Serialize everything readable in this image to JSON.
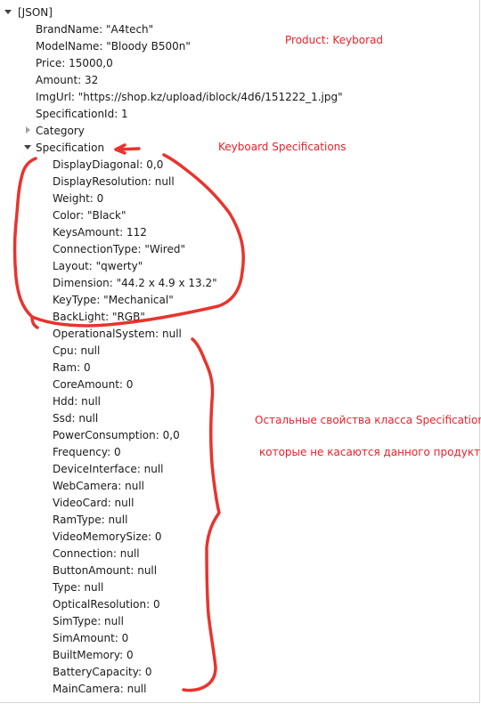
{
  "root": {
    "label": "[JSON]"
  },
  "product_fields": [
    "BrandName: \"A4tech\"",
    "ModelName: \"Bloody B500n\"",
    "Price: 15000,0",
    "Amount: 32",
    "ImgUrl: \"https://shop.kz/upload/iblock/4d6/151222_1.jpg\"",
    "SpecificationId: 1"
  ],
  "category_node": {
    "label": "Category"
  },
  "specification_node": {
    "label": "Specification"
  },
  "keyboard_specs": [
    "DisplayDiagonal: 0,0",
    "DisplayResolution: null",
    "Weight: 0",
    "Color: \"Black\"",
    "KeysAmount: 112",
    "ConnectionType: \"Wired\"",
    "Layout: \"qwerty\"",
    "Dimension: \"44.2 x 4.9 x 13.2\"",
    "KeyType: \"Mechanical\"",
    "BackLight: \"RGB\""
  ],
  "other_specs": [
    "OperationalSystem: null",
    "Cpu: null",
    "Ram: 0",
    "CoreAmount: 0",
    "Hdd: null",
    "Ssd: null",
    "PowerConsumption: 0,0",
    "Frequency: 0",
    "DeviceInterface: null",
    "WebCamera: null",
    "VideoCard: null",
    "RamType: null",
    "VideoMemorySize: 0",
    "Connection: null",
    "ButtonAmount: null",
    "Type: null",
    "OpticalResolution: 0",
    "SimType: null",
    "SimAmount: 0",
    "BuiltMemory: 0",
    "BatteryCapacity: 0",
    "MainCamera: null"
  ],
  "annotations": {
    "product": "Product: Keyborad",
    "keyboard_specs": "Keyboard Specifications",
    "other_line1": "Остальные свойства класса Specification",
    "other_line2": "которые не касаются данного продукта"
  },
  "colors": {
    "annotation": "#e8222a",
    "text": "#1a1a1a"
  }
}
